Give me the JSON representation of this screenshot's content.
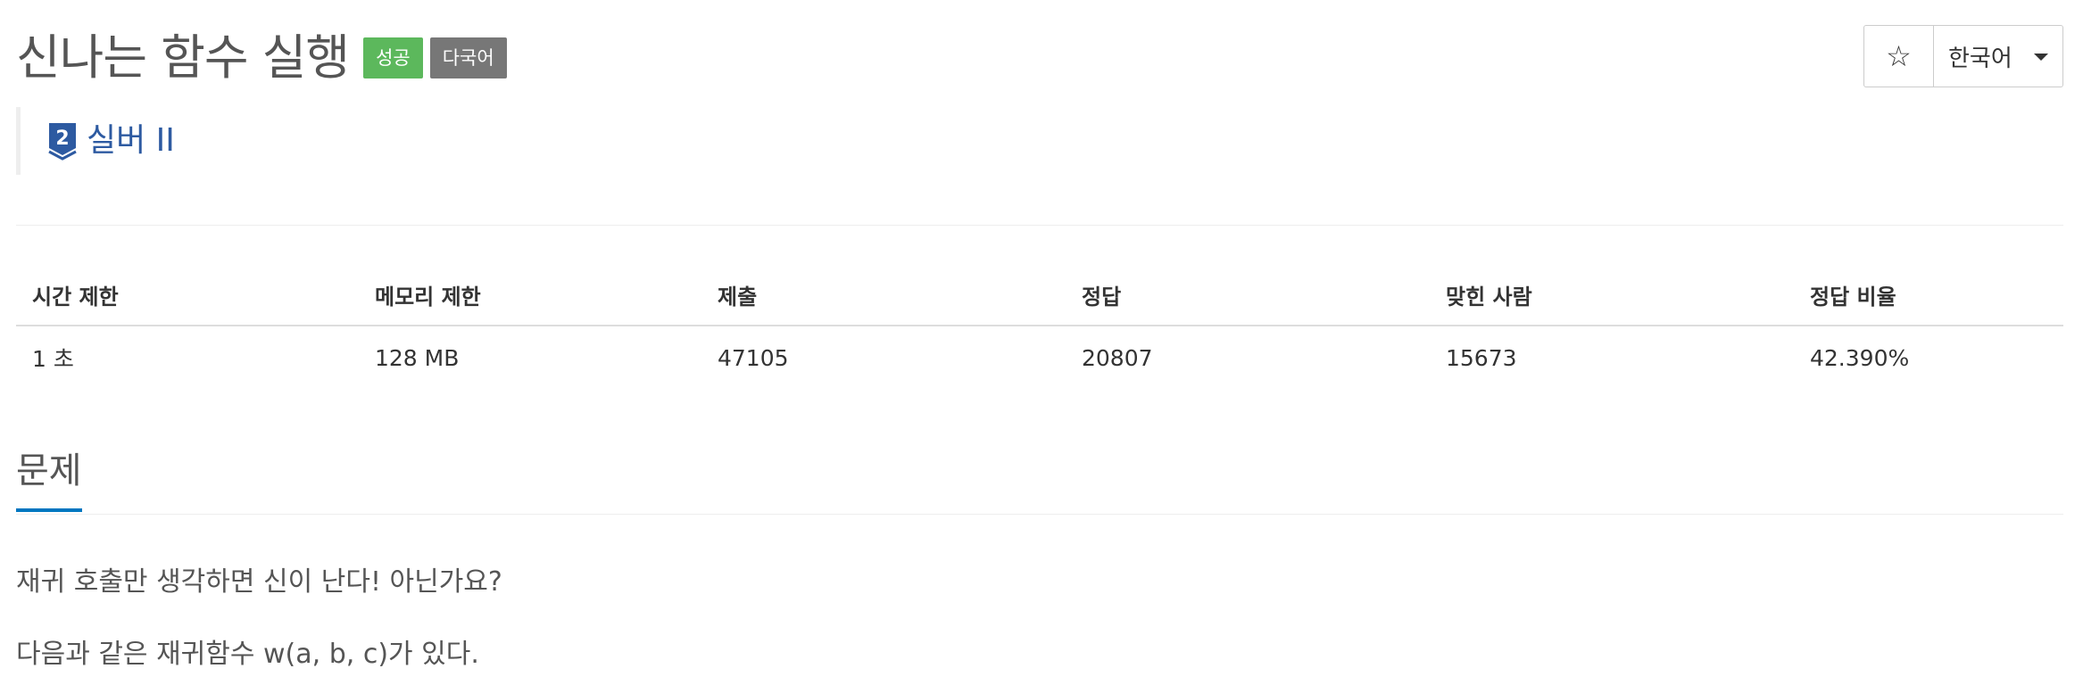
{
  "problem": {
    "title": "신나는 함수 실행",
    "labels": [
      {
        "text": "성공",
        "color": "#5cb85c"
      },
      {
        "text": "다국어",
        "color": "#777777"
      }
    ],
    "tier": {
      "number": "2",
      "name": "실버 II",
      "color": "#2d5aa1"
    }
  },
  "actions": {
    "star_icon": "☆",
    "language": "한국어"
  },
  "info_table": {
    "headers": [
      "시간 제한",
      "메모리 제한",
      "제출",
      "정답",
      "맞힌 사람",
      "정답 비율"
    ],
    "row": [
      "1 초",
      "128 MB",
      "47105",
      "20807",
      "15673",
      "42.390%"
    ]
  },
  "section": {
    "title": "문제",
    "accent_color": "#0076c0",
    "paragraphs": [
      "재귀 호출만 생각하면 신이 난다! 아닌가요?",
      "다음과 같은 재귀함수 w(a, b, c)가 있다."
    ]
  }
}
